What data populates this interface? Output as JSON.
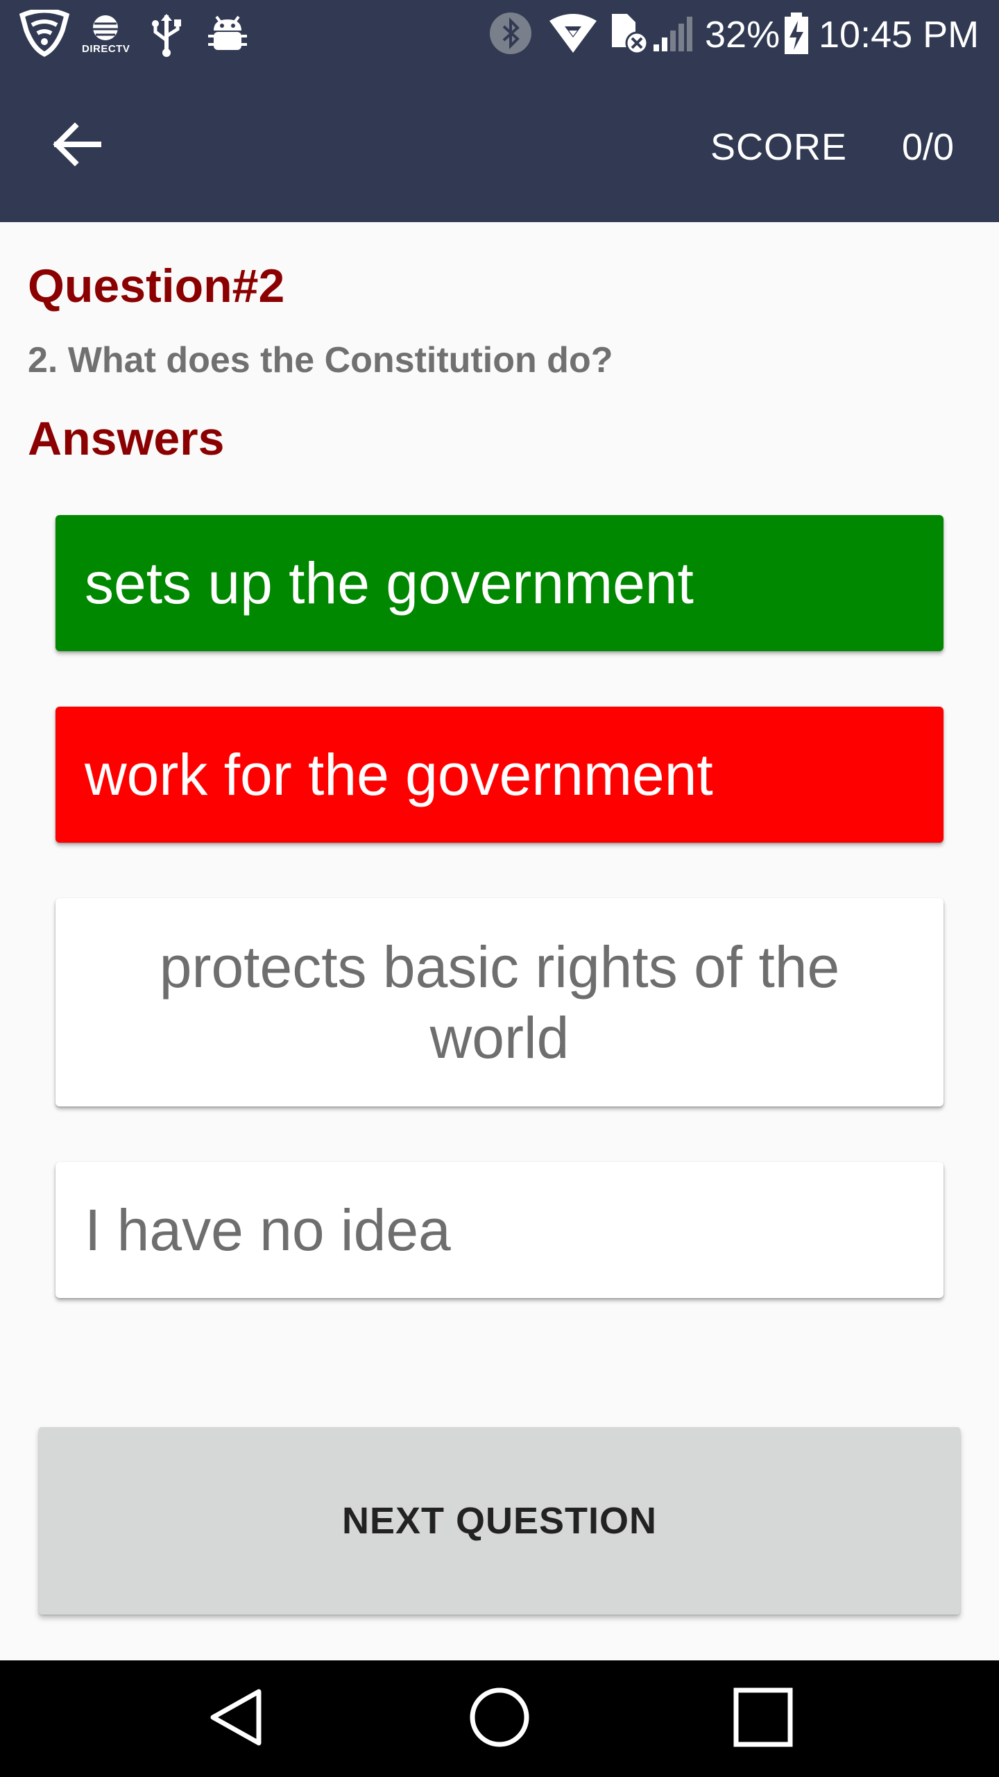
{
  "status_bar": {
    "directv_label": "DIRECTV",
    "battery_percent": "32%",
    "time": "10:45 PM",
    "icons": [
      "shield-icon",
      "directv-icon",
      "usb-icon",
      "android-debug-icon",
      "bluetooth-icon",
      "wifi-icon",
      "no-sim-icon",
      "signal-icon",
      "battery-charging-icon"
    ]
  },
  "app_bar": {
    "back_icon": "arrow-left-icon",
    "score_label": "SCORE",
    "score_value": "0/0"
  },
  "quiz": {
    "question_title": "Question#2",
    "question_text": "2. What does the Constitution do?",
    "answers_title": "Answers",
    "answers": [
      {
        "label": "sets up the government",
        "state": "correct",
        "color": "#008800"
      },
      {
        "label": "work for the government",
        "state": "wrong",
        "color": "#ff0000"
      },
      {
        "label": "protects basic rights of the world",
        "state": "neutral",
        "color": "#ffffff"
      },
      {
        "label": "I have no idea",
        "state": "neutral",
        "color": "#ffffff"
      }
    ],
    "next_button_label": "NEXT QUESTION"
  },
  "nav_bar": {
    "buttons": [
      "back-triangle-icon",
      "home-circle-icon",
      "recents-square-icon"
    ]
  },
  "colors": {
    "app_bar_bg": "#313a52",
    "heading_red": "#8b0000",
    "next_button_bg": "#d6d7d7"
  }
}
